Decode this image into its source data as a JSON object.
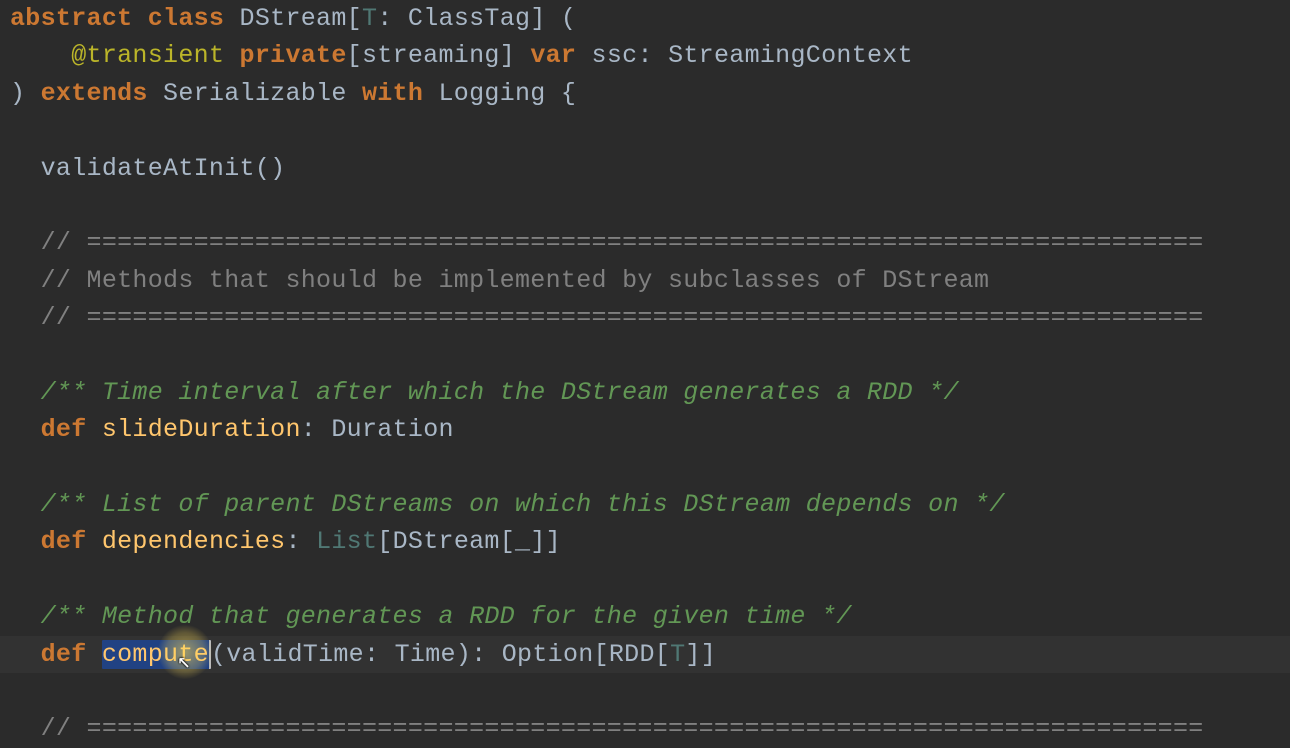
{
  "code": {
    "l1": {
      "t1": "abstract class ",
      "t2": "DStream",
      "t3": "[",
      "t4": "T",
      "t5": ": ",
      "t6": "ClassTag",
      "t7": "] ("
    },
    "l2": {
      "t1": "    ",
      "t2": "@transient ",
      "t3": "private",
      "t4": "[streaming] ",
      "t5": "var ",
      "t6": "ssc",
      "t7": ": ",
      "t8": "StreamingContext"
    },
    "l3": {
      "t1": ") ",
      "t2": "extends ",
      "t3": "Serializable ",
      "t4": "with ",
      "t5": "Logging {"
    },
    "l4": {
      "t1": ""
    },
    "l5": {
      "t1": "  validateAtInit()"
    },
    "l6": {
      "t1": ""
    },
    "l7": {
      "t1": "  // ========================================================================="
    },
    "l8": {
      "t1": "  // Methods that should be implemented by subclasses of DStream"
    },
    "l9": {
      "t1": "  // ========================================================================="
    },
    "l10": {
      "t1": ""
    },
    "l11": {
      "t1": "  /** Time interval after which the DStream generates a RDD */"
    },
    "l12": {
      "t1": "  ",
      "t2": "def ",
      "t3": "slideDuration",
      "t4": ": ",
      "t5": "Duration"
    },
    "l13": {
      "t1": ""
    },
    "l14": {
      "t1": "  /** List of parent DStreams on which this DStream depends on */"
    },
    "l15": {
      "t1": "  ",
      "t2": "def ",
      "t3": "dependencies",
      "t4": ": ",
      "t5": "List",
      "t6": "[",
      "t7": "DStream",
      "t8": "[_]]"
    },
    "l16": {
      "t1": ""
    },
    "l17": {
      "t1": "  /** Method that generates a RDD for the given time */"
    },
    "l18": {
      "t1": "  ",
      "t2": "def ",
      "t3": "compute",
      "t4": "(validTime: ",
      "t5": "Time",
      "t6": "): ",
      "t7": "Option",
      "t8": "[",
      "t9": "RDD",
      "t10": "[",
      "t11": "T",
      "t12": "]]"
    },
    "l19": {
      "t1": ""
    },
    "l20": {
      "t1": "  // ========================================================================="
    }
  }
}
